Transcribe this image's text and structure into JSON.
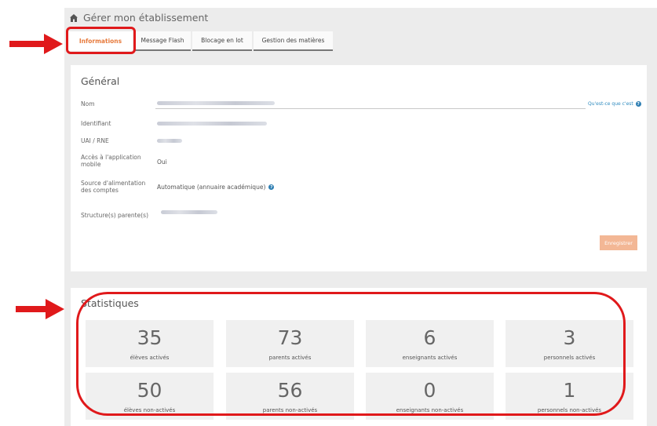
{
  "header": {
    "title": "Gérer mon établissement",
    "icon": "home-icon"
  },
  "tabs": [
    {
      "label": "Informations",
      "active": true
    },
    {
      "label": "Message Flash",
      "active": false
    },
    {
      "label": "Blocage en lot",
      "active": false
    },
    {
      "label": "Gestion des matières",
      "active": false
    }
  ],
  "general": {
    "title": "Général",
    "fields": {
      "nom": {
        "label": "Nom"
      },
      "identifiant": {
        "label": "Identifiant"
      },
      "uai": {
        "label": "UAI / RNE"
      },
      "acces": {
        "label": "Accès à l'application mobile",
        "value": "Oui"
      },
      "source": {
        "label": "Source d'alimentation des comptes",
        "value": "Automatique (annuaire académique)"
      },
      "structures": {
        "label": "Structure(s) parente(s)"
      }
    },
    "help_link": "Qu'est-ce que c'est",
    "save_label": "Enregistrer"
  },
  "stats": {
    "title": "Statistiques",
    "items": [
      {
        "value": "35",
        "label": "élèves activés"
      },
      {
        "value": "73",
        "label": "parents activés"
      },
      {
        "value": "6",
        "label": "enseignants activés"
      },
      {
        "value": "3",
        "label": "personnels activés"
      },
      {
        "value": "50",
        "label": "élèves non-activés"
      },
      {
        "value": "56",
        "label": "parents non-activés"
      },
      {
        "value": "0",
        "label": "enseignants non-activés"
      },
      {
        "value": "1",
        "label": "personnels non-activés"
      }
    ]
  },
  "colors": {
    "accent": "#e77a3c",
    "annotation": "#e0191b",
    "link": "#2f8bbf"
  }
}
